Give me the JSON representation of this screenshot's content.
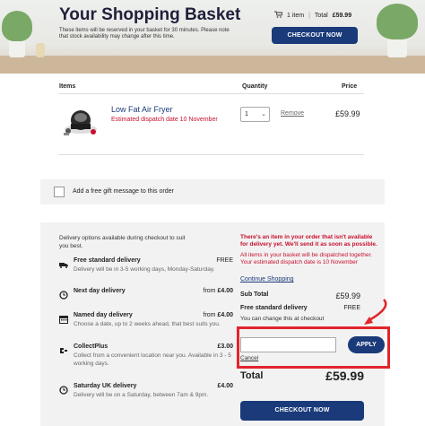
{
  "header": {
    "title": "Your Shopping Basket",
    "note": "These items will be reserved in your basket for 30 minutes. Please note that stock availability may change after this time.",
    "cart_count": "1 item",
    "total_label": "Total",
    "total_value": "£59.99",
    "checkout_label": "CHECKOUT NOW"
  },
  "items": {
    "col_items": "Items",
    "col_quantity": "Quantity",
    "col_price": "Price",
    "rows": [
      {
        "name": "Low Fat Air Fryer",
        "dispatch": "Estimated dispatch date 10 November",
        "quantity": "1",
        "remove_label": "Remove",
        "price": "£59.99"
      }
    ]
  },
  "gift": {
    "label": "Add a free gift message to this order"
  },
  "delivery": {
    "intro": "Delivery options available during checkout to suit you best.",
    "options": [
      {
        "icon": "truck-icon",
        "name": "Free standard delivery",
        "prefix": "",
        "amount": "FREE",
        "desc": "Delivery will be in 3-5 working days, Monday-Saturday."
      },
      {
        "icon": "clock-icon",
        "name": "Next day delivery",
        "prefix": "from",
        "amount": "£4.00",
        "desc": ""
      },
      {
        "icon": "calendar-icon",
        "name": "Named day delivery",
        "prefix": "from",
        "amount": "£4.00",
        "desc": "Choose a date, up to 2 weeks ahead, that best suits you."
      },
      {
        "icon": "collectplus-icon",
        "name": "CollectPlus",
        "prefix": "",
        "amount": "£3.00",
        "desc": "Collect from a convenient location near you. Available in 3 - 5 working days."
      },
      {
        "icon": "clock-icon",
        "name": "Saturday UK delivery",
        "prefix": "",
        "amount": "£4.00",
        "desc": "Delivery will be on a Saturday, between 7am & 9pm."
      }
    ]
  },
  "summary": {
    "warning": "There's an item in your order that isn't available for delivery yet. We'll send it as soon as possible.",
    "warning_detail": "All items in your basket will be dispatched together. Your estimated dispatch date is 10 November",
    "continue_label": "Continue Shopping",
    "subtotal_label": "Sub Total",
    "subtotal_value": "£59.99",
    "shipping_label": "Free standard delivery",
    "shipping_value": "FREE",
    "change_note": "You can change this at checkout",
    "promo_placeholder": "",
    "apply_label": "APPLY",
    "cancel_label": "Cancel",
    "total_label": "Total",
    "total_value": "£59.99",
    "checkout_label": "CHECKOUT NOW"
  },
  "colors": {
    "brand_blue": "#1a3a7a",
    "alert_red": "#c8102e",
    "highlight_red": "#e3242b"
  }
}
